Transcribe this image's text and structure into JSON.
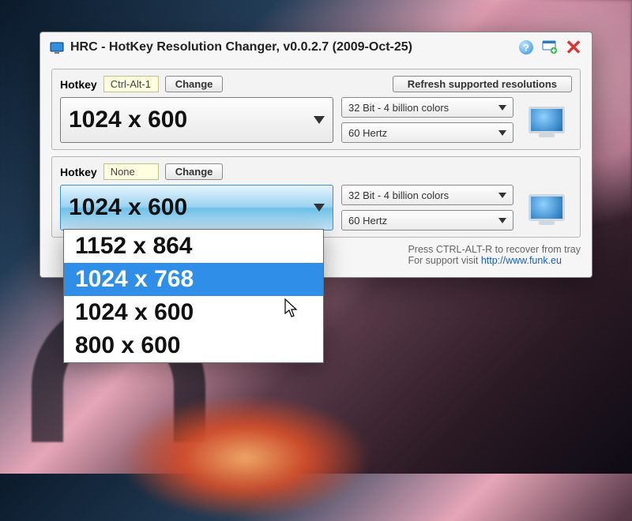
{
  "title": "HRC - HotKey Resolution Changer, v0.0.2.7 (2009-Oct-25)",
  "buttons": {
    "change": "Change",
    "refresh": "Refresh supported resolutions"
  },
  "labels": {
    "hotkey": "Hotkey"
  },
  "slot1": {
    "hotkey": "Ctrl-Alt-1",
    "resolution": "1024 x 600",
    "color_depth": "32 Bit - 4 billion colors",
    "refresh_rate": "60 Hertz"
  },
  "slot2": {
    "hotkey": "None",
    "resolution": "1024 x 600",
    "color_depth": "32 Bit - 4 billion colors",
    "refresh_rate": "60 Hertz"
  },
  "dropdown": {
    "options": [
      "1152 x 864",
      "1024 x 768",
      "1024 x 600",
      "800 x 600"
    ],
    "highlighted_index": 1
  },
  "footer": {
    "hint": "Press CTRL-ALT-R to recover from tray",
    "support_prefix": "For support visit ",
    "support_url": "http://www.funk.eu"
  }
}
